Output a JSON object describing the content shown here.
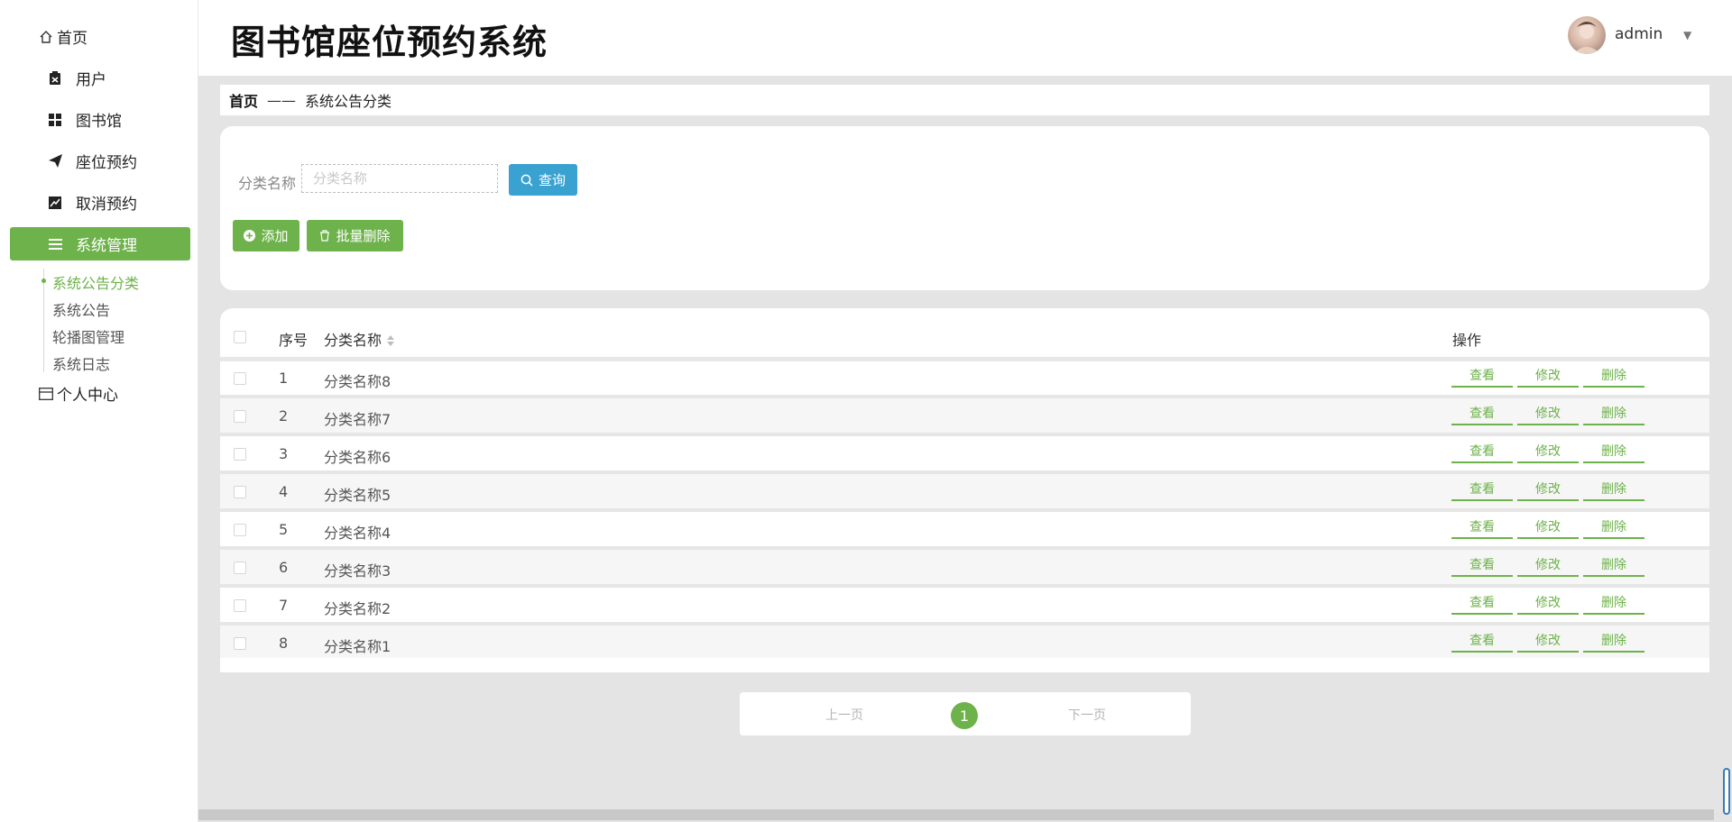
{
  "app_title": "图书馆座位预约系统",
  "user": {
    "name": "admin"
  },
  "sidebar": {
    "items": [
      {
        "label": "首页",
        "icon": "home-icon"
      },
      {
        "label": "用户",
        "icon": "clipboard-icon"
      },
      {
        "label": "图书馆",
        "icon": "grid-icon"
      },
      {
        "label": "座位预约",
        "icon": "send-icon"
      },
      {
        "label": "取消预约",
        "icon": "chart-icon"
      },
      {
        "label": "系统管理",
        "icon": "list-icon",
        "active": true
      },
      {
        "label": "个人中心",
        "icon": "card-icon"
      }
    ],
    "sub_items": [
      {
        "label": "系统公告分类",
        "active": true
      },
      {
        "label": "系统公告"
      },
      {
        "label": "轮播图管理"
      },
      {
        "label": "系统日志"
      }
    ]
  },
  "breadcrumb": {
    "home": "首页",
    "separator": "——",
    "current": "系统公告分类"
  },
  "search": {
    "label": "分类名称",
    "placeholder": "分类名称",
    "value": "",
    "query_button": "查询"
  },
  "actions": {
    "add": "添加",
    "batch_delete": "批量删除"
  },
  "table": {
    "columns": {
      "index": "序号",
      "name": "分类名称",
      "ops": "操作"
    },
    "rows": [
      {
        "index": "1",
        "name": "分类名称8"
      },
      {
        "index": "2",
        "name": "分类名称7"
      },
      {
        "index": "3",
        "name": "分类名称6"
      },
      {
        "index": "4",
        "name": "分类名称5"
      },
      {
        "index": "5",
        "name": "分类名称4"
      },
      {
        "index": "6",
        "name": "分类名称3"
      },
      {
        "index": "7",
        "name": "分类名称2"
      },
      {
        "index": "8",
        "name": "分类名称1"
      }
    ],
    "row_buttons": {
      "view": "查看",
      "edit": "修改",
      "delete": "删除"
    }
  },
  "pagination": {
    "prev": "上一页",
    "current": "1",
    "next": "下一页"
  },
  "colors": {
    "accent": "#6db24a",
    "query": "#3aa2d0"
  }
}
